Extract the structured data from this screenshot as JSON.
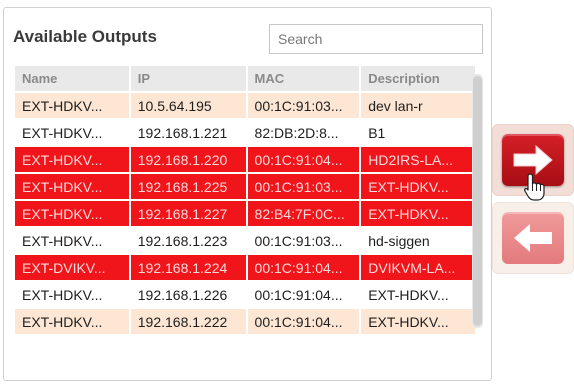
{
  "panel": {
    "title": "Available Outputs",
    "search": {
      "placeholder": "Search",
      "value": ""
    }
  },
  "table": {
    "columns": [
      "Name",
      "IP",
      "MAC",
      "Description"
    ],
    "rows": [
      {
        "name": "EXT-HDKV...",
        "ip": "10.5.64.195",
        "mac": "00:1C:91:03...",
        "description": "dev lan-r",
        "state": "hover"
      },
      {
        "name": "EXT-HDKV...",
        "ip": "192.168.1.221",
        "mac": "82:DB:2D:8...",
        "description": "B1",
        "state": "normal"
      },
      {
        "name": "EXT-HDKV...",
        "ip": "192.168.1.220",
        "mac": "00:1C:91:04...",
        "description": "HD2IRS-LA...",
        "state": "selected"
      },
      {
        "name": "EXT-HDKV...",
        "ip": "192.168.1.225",
        "mac": "00:1C:91:03...",
        "description": "EXT-HDKV...",
        "state": "selected"
      },
      {
        "name": "EXT-HDKV...",
        "ip": "192.168.1.227",
        "mac": "82:B4:7F:0C...",
        "description": "EXT-HDKV...",
        "state": "selected"
      },
      {
        "name": "EXT-HDKV...",
        "ip": "192.168.1.223",
        "mac": "00:1C:91:03...",
        "description": "hd-siggen",
        "state": "normal"
      },
      {
        "name": "EXT-DVIKV...",
        "ip": "192.168.1.224",
        "mac": "00:1C:91:04...",
        "description": "DVIKVM-LA...",
        "state": "selected"
      },
      {
        "name": "EXT-HDKV...",
        "ip": "192.168.1.226",
        "mac": "00:1C:91:04...",
        "description": "EXT-HDKV...",
        "state": "normal"
      },
      {
        "name": "EXT-HDKV...",
        "ip": "192.168.1.222",
        "mac": "00:1C:91:04...",
        "description": "EXT-HDKV...",
        "state": "hover"
      }
    ]
  },
  "buttons": {
    "move_right_icon": "arrow-right-icon",
    "move_left_icon": "arrow-left-icon"
  },
  "colors": {
    "selected_row": "#f0151b",
    "hover_row": "#fde7d4",
    "move_right_button": "#c8141b",
    "move_left_button": "#eb8a8c"
  }
}
